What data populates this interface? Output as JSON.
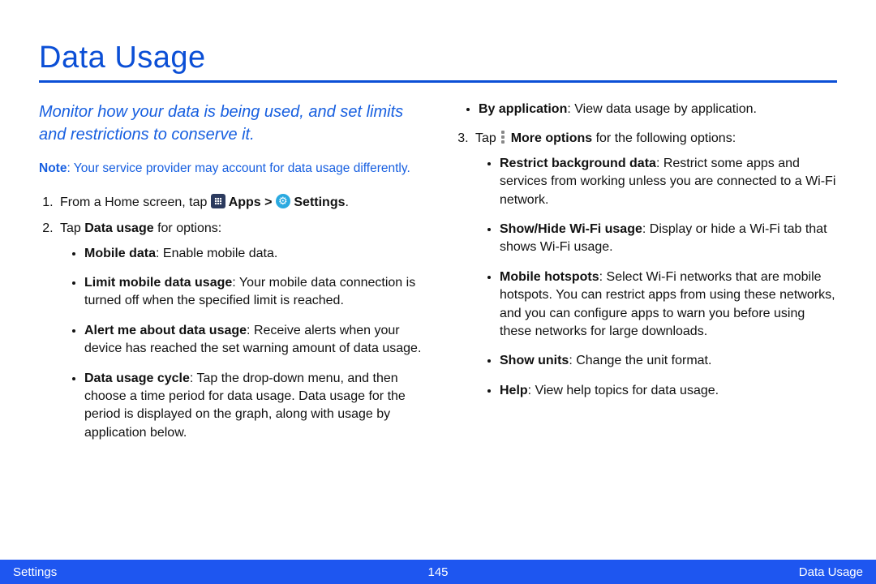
{
  "title": "Data Usage",
  "intro": "Monitor how your data is being used, and set limits and restrictions to conserve it.",
  "note_label": "Note",
  "note_text": ": Your service provider may account for data usage differently.",
  "step1_prefix": "From a Home screen, tap ",
  "step1_apps": " Apps > ",
  "step1_settings": " Settings",
  "step1_period": ".",
  "step2_prefix": "Tap ",
  "step2_bold": "Data usage",
  "step2_suffix": " for options:",
  "s2b1_label": "Mobile data",
  "s2b1_text": ": Enable mobile data.",
  "s2b2_label": "Limit mobile data usage",
  "s2b2_text": ": Your mobile data connection is turned off when the specified limit is reached.",
  "s2b3_label": "Alert me about data usage",
  "s2b3_text": ": Receive alerts when your device has reached the set warning amount of data usage.",
  "s2b4_label": "Data usage cycle",
  "s2b4_text": ": Tap the drop-down menu, and then choose a time period for data usage. Data usage for the period is displayed on the graph, along with usage by application below.",
  "s2b5_label": "By application",
  "s2b5_text": ": View data usage by application.",
  "step3_prefix": "Tap ",
  "step3_bold": " More options",
  "step3_suffix": " for the following options:",
  "s3b1_label": "Restrict background data",
  "s3b1_text": ": Restrict some apps and services from working unless you are connected to a Wi-Fi network.",
  "s3b2_label": "Show/Hide Wi-Fi usage",
  "s3b2_text": ": Display or hide a Wi-Fi tab that shows Wi-Fi usage.",
  "s3b3_label": "Mobile hotspots",
  "s3b3_text": ": Select Wi-Fi networks that are mobile hotspots. You can restrict apps from using these networks, and you can configure apps to warn you before using these networks for large downloads.",
  "s3b4_label": "Show units",
  "s3b4_text": ": Change the unit format.",
  "s3b5_label": "Help",
  "s3b5_text": ": View help topics for data usage.",
  "footer_left": "Settings",
  "footer_center": "145",
  "footer_right": "Data Usage"
}
